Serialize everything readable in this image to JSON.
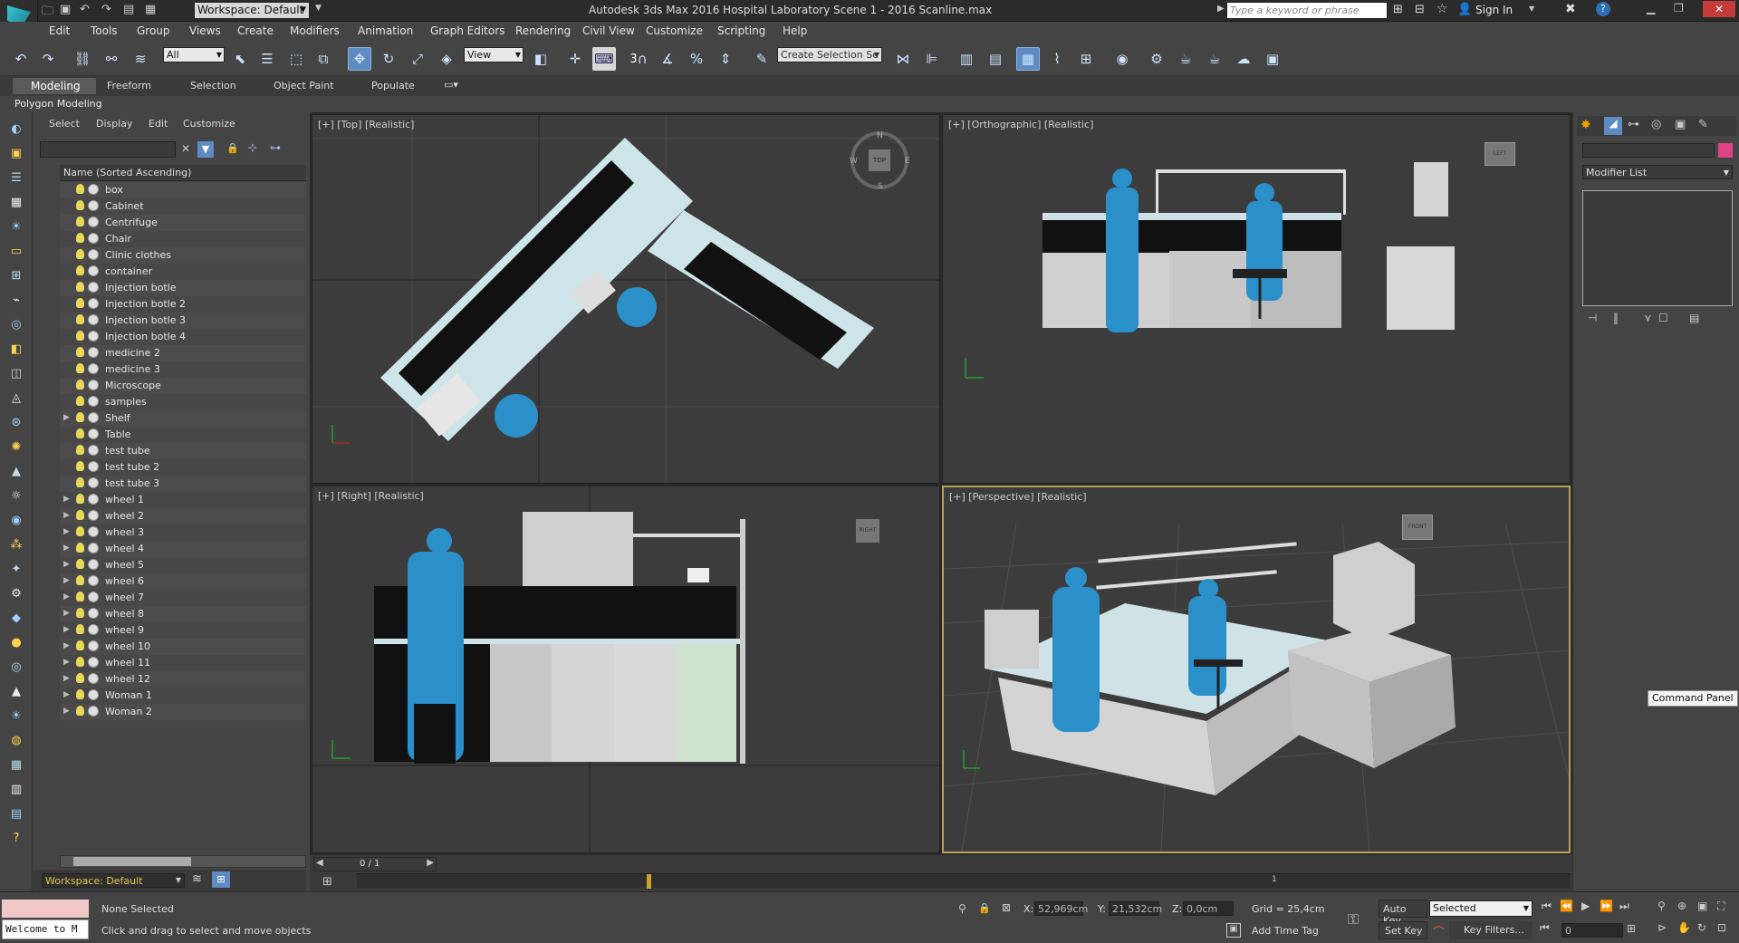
{
  "window": {
    "title": "Autodesk 3ds Max 2016     Hospital Laboratory Scene 1 - 2016 Scanline.max",
    "workspace": "Workspace: Default",
    "search_placeholder": "Type a keyword or phrase",
    "sign_in": "Sign In"
  },
  "menu": [
    "Edit",
    "Tools",
    "Group",
    "Views",
    "Create",
    "Modifiers",
    "Animation",
    "Graph Editors",
    "Rendering",
    "Civil View",
    "Customize",
    "Scripting",
    "Help"
  ],
  "toolbar": {
    "filter": "All",
    "ref_coord": "View",
    "selection_set": "Create Selection Se",
    "snap_label": "3"
  },
  "ribbon": {
    "tabs": [
      "Modeling",
      "Freeform",
      "Selection",
      "Object Paint",
      "Populate"
    ],
    "panel": "Polygon Modeling"
  },
  "explorer": {
    "menu": [
      "Select",
      "Display",
      "Edit",
      "Customize"
    ],
    "column_header": "Name (Sorted Ascending)",
    "items": [
      {
        "name": "box",
        "expandable": false
      },
      {
        "name": "Cabinet",
        "expandable": false
      },
      {
        "name": "Centrifuge",
        "expandable": false
      },
      {
        "name": "Chair",
        "expandable": false
      },
      {
        "name": "Clinic clothes",
        "expandable": false
      },
      {
        "name": "container",
        "expandable": false
      },
      {
        "name": "Injection botle",
        "expandable": false
      },
      {
        "name": "Injection botle 2",
        "expandable": false
      },
      {
        "name": "Injection botle 3",
        "expandable": false
      },
      {
        "name": "Injection botle 4",
        "expandable": false
      },
      {
        "name": "medicine 2",
        "expandable": false
      },
      {
        "name": "medicine 3",
        "expandable": false
      },
      {
        "name": "Microscope",
        "expandable": false
      },
      {
        "name": "samples",
        "expandable": false
      },
      {
        "name": "Shelf",
        "expandable": true
      },
      {
        "name": "Table",
        "expandable": false
      },
      {
        "name": "test tube",
        "expandable": false
      },
      {
        "name": "test tube 2",
        "expandable": false
      },
      {
        "name": "test tube 3",
        "expandable": false
      },
      {
        "name": "wheel 1",
        "expandable": true
      },
      {
        "name": "wheel 2",
        "expandable": true
      },
      {
        "name": "wheel 3",
        "expandable": true
      },
      {
        "name": "wheel 4",
        "expandable": true
      },
      {
        "name": "wheel 5",
        "expandable": true
      },
      {
        "name": "wheel 6",
        "expandable": true
      },
      {
        "name": "wheel 7",
        "expandable": true
      },
      {
        "name": "wheel 8",
        "expandable": true
      },
      {
        "name": "wheel 9",
        "expandable": true
      },
      {
        "name": "wheel 10",
        "expandable": true
      },
      {
        "name": "wheel 11",
        "expandable": true
      },
      {
        "name": "wheel 12",
        "expandable": true
      },
      {
        "name": "Woman 1",
        "expandable": true
      },
      {
        "name": "Woman 2",
        "expandable": true
      }
    ],
    "workspace_footer": "Workspace: Default"
  },
  "viewports": {
    "top": "[+] [Top] [Realistic]",
    "ortho": "[+] [Orthographic] [Realistic]",
    "right": "[+] [Right] [Realistic]",
    "persp": "[+] [Perspective] [Realistic]",
    "viewcube_top": "TOP",
    "viewcube_right": "RIGHT",
    "viewcube_front": "FRONT",
    "viewcube_left": "LEFT",
    "compass": [
      "N",
      "E",
      "S",
      "W"
    ]
  },
  "command_panel": {
    "modifier_list": "Modifier List",
    "tooltip": "Command Panel",
    "accent_color": "#e0438a"
  },
  "timeline": {
    "frame": "0 / 1",
    "tick_1": "1"
  },
  "status": {
    "listener": "Welcome to M",
    "selection": "None Selected",
    "prompt": "Click and drag to select and move objects",
    "x_label": "X:",
    "x": "52,969cm",
    "y_label": "Y:",
    "y": "21,532cm",
    "z_label": "Z:",
    "z": "0,0cm",
    "grid": "Grid = 25,4cm",
    "add_time_tag": "Add Time Tag",
    "auto_key": "Auto Key",
    "set_key": "Set Key",
    "key_mode": "Selected",
    "key_filters": "Key Filters...",
    "frame_field": "0"
  },
  "colors": {
    "ui_bg": "#444444",
    "viewport_bg": "#3c3c3c",
    "active_border": "#b8a05a",
    "selected_tool": "#5d8bc2",
    "scrub_bar": "#c9a227",
    "character_blue": "#2b8fc9"
  }
}
